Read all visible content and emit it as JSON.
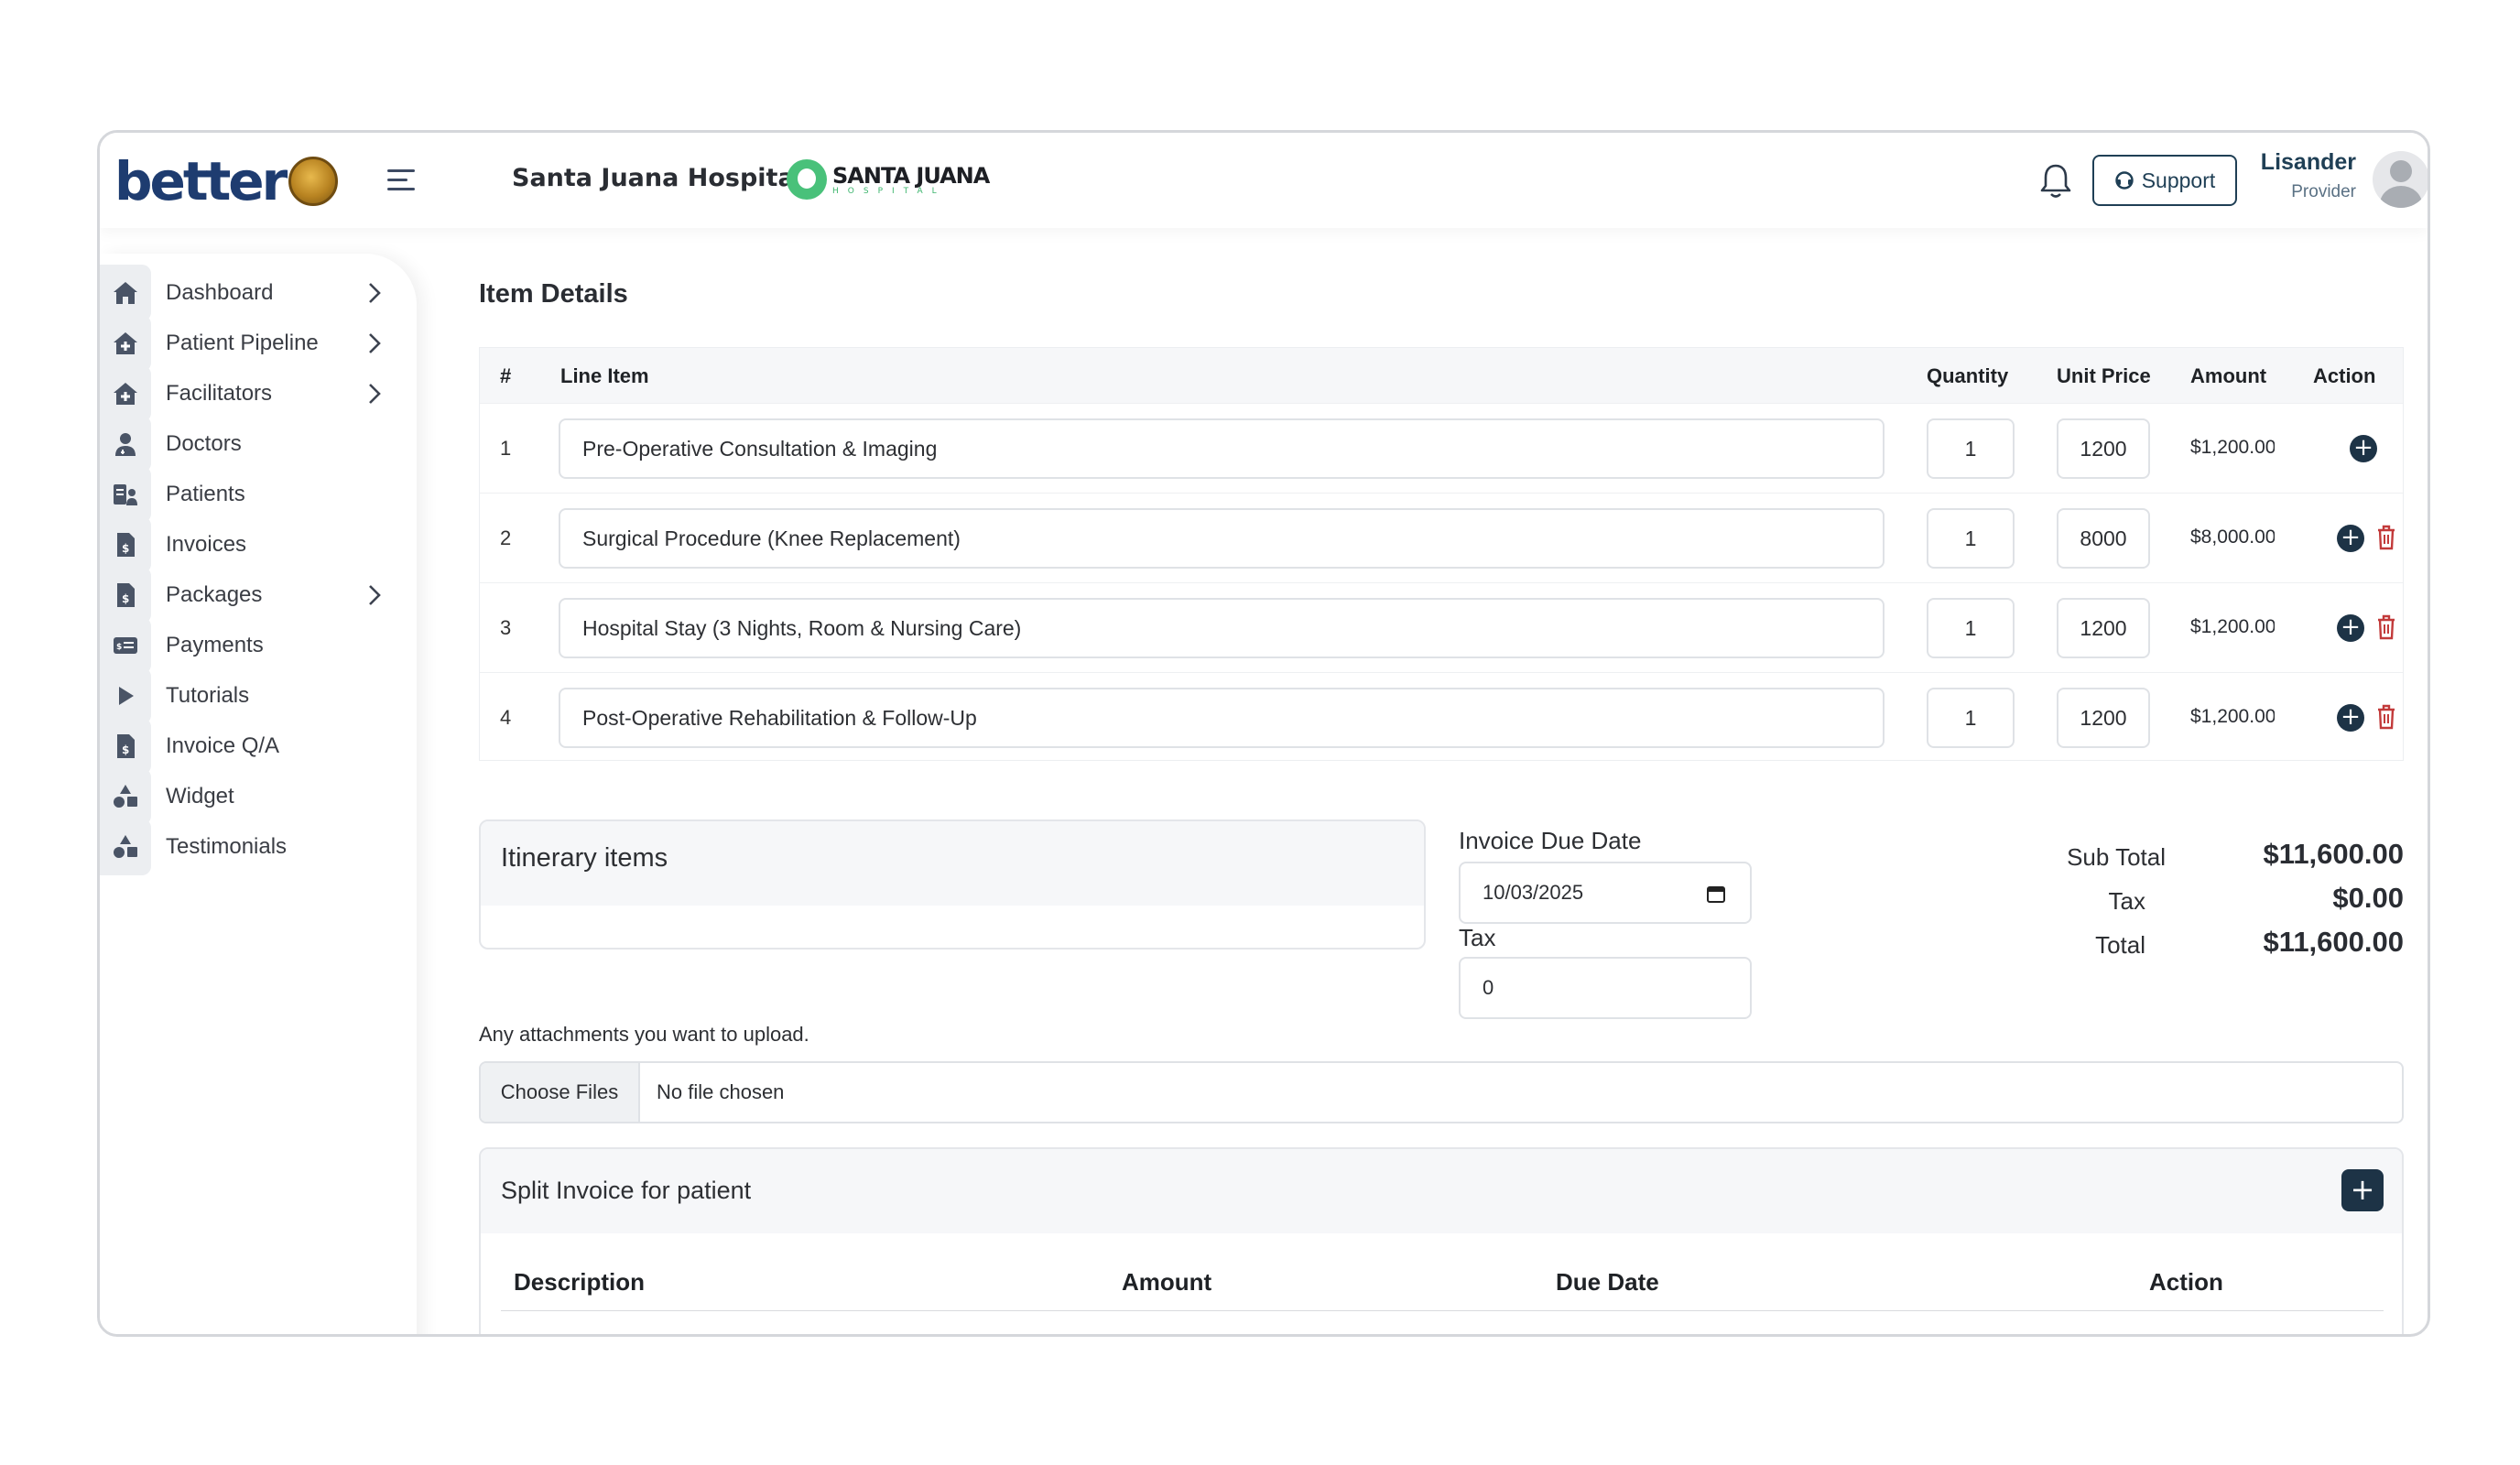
{
  "header": {
    "logo_text": "better",
    "hospital_name": "Santa Juana Hospital",
    "hospital_logo_text": "SANTA JUANA",
    "hospital_logo_subtext": "HOSPITAL",
    "support_label": "Support",
    "user_name": "Lisander",
    "user_role": "Provider"
  },
  "sidebar": {
    "items": [
      {
        "label": "Dashboard",
        "icon": "home-icon",
        "has_chevron": true
      },
      {
        "label": "Patient Pipeline",
        "icon": "house-plus-icon",
        "has_chevron": true
      },
      {
        "label": "Facilitators",
        "icon": "house-plus-icon",
        "has_chevron": true
      },
      {
        "label": "Doctors",
        "icon": "doctor-icon",
        "has_chevron": false
      },
      {
        "label": "Patients",
        "icon": "patients-icon",
        "has_chevron": false
      },
      {
        "label": "Invoices",
        "icon": "invoice-icon",
        "has_chevron": false
      },
      {
        "label": "Packages",
        "icon": "invoice-icon",
        "has_chevron": true
      },
      {
        "label": "Payments",
        "icon": "payment-card-icon",
        "has_chevron": false
      },
      {
        "label": "Tutorials",
        "icon": "play-icon",
        "has_chevron": false
      },
      {
        "label": "Invoice Q/A",
        "icon": "invoice-icon",
        "has_chevron": false
      },
      {
        "label": "Widget",
        "icon": "shapes-icon",
        "has_chevron": false
      },
      {
        "label": "Testimonials",
        "icon": "shapes-icon",
        "has_chevron": false
      }
    ]
  },
  "items": {
    "title": "Item Details",
    "columns": [
      "#",
      "Line Item",
      "Quantity",
      "Unit Price",
      "Amount",
      "Action"
    ],
    "rows": [
      {
        "num": "1",
        "line_item": "Pre-Operative Consultation & Imaging",
        "quantity": "1",
        "unit_price": "1200",
        "amount": "$1,200.00",
        "can_delete": false
      },
      {
        "num": "2",
        "line_item": "Surgical Procedure (Knee Replacement)",
        "quantity": "1",
        "unit_price": "8000",
        "amount": "$8,000.00",
        "can_delete": true
      },
      {
        "num": "3",
        "line_item": "Hospital Stay (3 Nights, Room & Nursing Care)",
        "quantity": "1",
        "unit_price": "1200",
        "amount": "$1,200.00",
        "can_delete": true
      },
      {
        "num": "4",
        "line_item": "Post-Operative Rehabilitation & Follow-Up",
        "quantity": "1",
        "unit_price": "1200",
        "amount": "$1,200.00",
        "can_delete": true
      }
    ]
  },
  "itinerary": {
    "title": "Itinerary items"
  },
  "invoice": {
    "due_date_label": "Invoice Due Date",
    "due_date_value": "10/03/2025",
    "tax_label": "Tax",
    "tax_value": "0"
  },
  "summary": {
    "sub_total_label": "Sub Total",
    "sub_total": "$11,600.00",
    "tax_label": "Tax",
    "tax": "$0.00",
    "total_label": "Total",
    "total": "$11,600.00"
  },
  "attachments": {
    "label": "Any attachments you want to upload.",
    "button_label": "Choose Files",
    "status": "No file chosen"
  },
  "split": {
    "title": "Split Invoice for patient",
    "add_label": "+",
    "columns": [
      "Description",
      "Amount",
      "Due Date",
      "Action"
    ]
  },
  "colors": {
    "accent_dark": "#1d3346",
    "delete_red": "#c23a3a",
    "brand_blue": "#1e3c70",
    "hospital_green": "#49c17a"
  }
}
